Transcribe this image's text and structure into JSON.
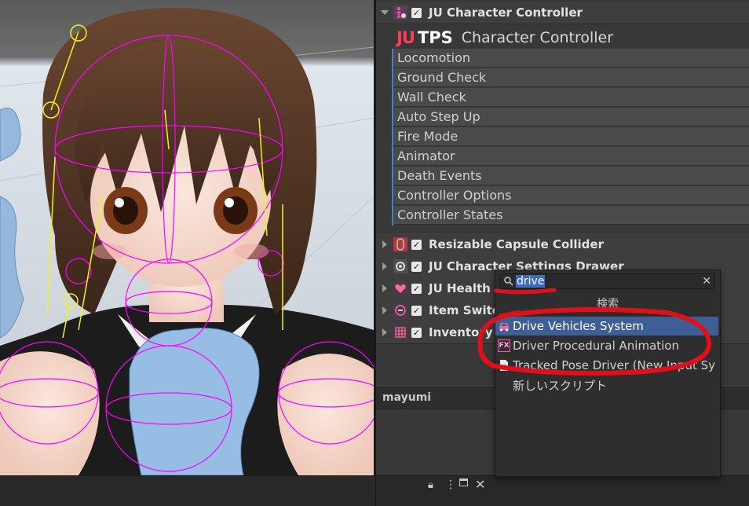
{
  "inspector": {
    "header_title": "JU Character Controller",
    "logo": {
      "ju": "JU",
      "tps": "TPS",
      "subtitle": "Character Controller"
    },
    "sections": [
      "Locomotion",
      "Ground Check",
      "Wall Check",
      "Auto Step Up",
      "Fire Mode",
      "Animator",
      "Death Events",
      "Controller Options",
      "Controller States"
    ],
    "components": [
      {
        "title": "Resizable Capsule Collider",
        "icon": "capsule-collider-icon"
      },
      {
        "title": "JU Character Settings Drawer",
        "icon": "settings-drawer-icon"
      },
      {
        "title": "JU Health",
        "icon": "heart-icon"
      },
      {
        "title": "Item Switch",
        "icon": "item-switch-icon"
      },
      {
        "title": "Inventory",
        "icon": "inventory-grid-icon"
      }
    ],
    "object_name": "mayumi"
  },
  "add_component_dropdown": {
    "search_value": "drive",
    "category": "検索",
    "items": [
      {
        "label": "Drive Vehicles System",
        "icon": "car-icon",
        "selected": true
      },
      {
        "label": "Driver Procedural Animation",
        "icon": "fx-icon",
        "selected": false
      },
      {
        "label": "Tracked Pose Driver (New Input Sy",
        "icon": "script-icon",
        "selected": false
      },
      {
        "label": "新しいスクリプト",
        "icon": "",
        "selected": false
      }
    ]
  },
  "colors": {
    "selection": "#3e5f96",
    "accent": "#3d82c4",
    "brand_ju": "#ff3a5a",
    "annotation": "#e0101a"
  }
}
